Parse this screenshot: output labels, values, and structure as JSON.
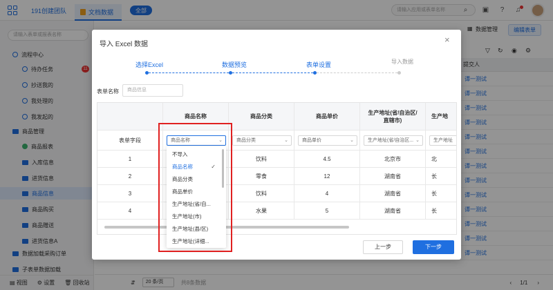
{
  "topbar": {
    "team_name": "191创建团队",
    "app_tab": "文档数据",
    "all_button": "全部",
    "search_placeholder": "请输入应用或表单名称"
  },
  "sidebar": {
    "search_placeholder": "请输入表单或报表名称",
    "groups": [
      {
        "label": "流程中心"
      },
      {
        "label": "商品管理"
      }
    ],
    "items": [
      {
        "label": "待办任务",
        "badge": "11"
      },
      {
        "label": "抄送我的"
      },
      {
        "label": "我处理的"
      },
      {
        "label": "我发起的"
      },
      {
        "label": "商品报表"
      },
      {
        "label": "入库信息"
      },
      {
        "label": "进货信息"
      },
      {
        "label": "商品信息"
      },
      {
        "label": "商品购买"
      },
      {
        "label": "商品赠送"
      },
      {
        "label": "进货信息A"
      },
      {
        "label": "数据加载采购订单"
      },
      {
        "label": "子表单数据加载"
      }
    ],
    "bottom": {
      "view": "视图",
      "settings": "设置",
      "recycle": "回收站"
    }
  },
  "main": {
    "data_manage": "数据管理",
    "edit_form": "编辑表单",
    "table_header": "提交人",
    "rows": [
      "谭一测试",
      "谭一测试",
      "谭一测试",
      "谭一测试",
      "谭一测试",
      "谭一测试",
      "谭一测试",
      "谭一测试",
      "谭一测试",
      "谭一测试",
      "谭一测试",
      "谭一测试",
      "谭一测试"
    ],
    "page_size": "20 条/页",
    "total": "共8条数据",
    "page": "1",
    "page_total": "1"
  },
  "modal": {
    "title": "导入 Excel 数据",
    "steps": [
      {
        "label": "选择Excel",
        "state": "done"
      },
      {
        "label": "数据预览",
        "state": "done"
      },
      {
        "label": "表单设置",
        "state": "active"
      },
      {
        "label": "导入数据",
        "state": "pending"
      }
    ],
    "form_name_label": "表单名称",
    "form_name_placeholder": "商品信息",
    "table": {
      "row_header": "表单字段",
      "columns": [
        "商品名称",
        "商品分类",
        "商品单价",
        "生产地址(省/自治区/直辖市)",
        "生产地"
      ],
      "selects": [
        "商品名称",
        "商品分类",
        "商品单价",
        "生产地址(省/自治区...",
        "生产地址"
      ],
      "rows": [
        {
          "index": "1",
          "category": "饮料",
          "price": "4.5",
          "region": "北京市",
          "more": "北"
        },
        {
          "index": "2",
          "category": "零食",
          "price": "12",
          "region": "湖南省",
          "more": "长"
        },
        {
          "index": "3",
          "category": "饮料",
          "price": "4",
          "region": "湖南省",
          "more": "长"
        },
        {
          "index": "4",
          "category": "水果",
          "price": "5",
          "region": "湖南省",
          "more": "长"
        }
      ]
    },
    "dropdown": {
      "options": [
        "不导入",
        "商品名称",
        "商品分类",
        "商品单价",
        "生产地址(省/自...",
        "生产地址(市)",
        "生产地址(县/区)",
        "生产地址(详细..."
      ],
      "selected": "商品名称"
    },
    "prev_button": "上一步",
    "next_button": "下一步"
  },
  "colors": {
    "primary": "#1f6fe0",
    "highlight": "#e02020"
  }
}
